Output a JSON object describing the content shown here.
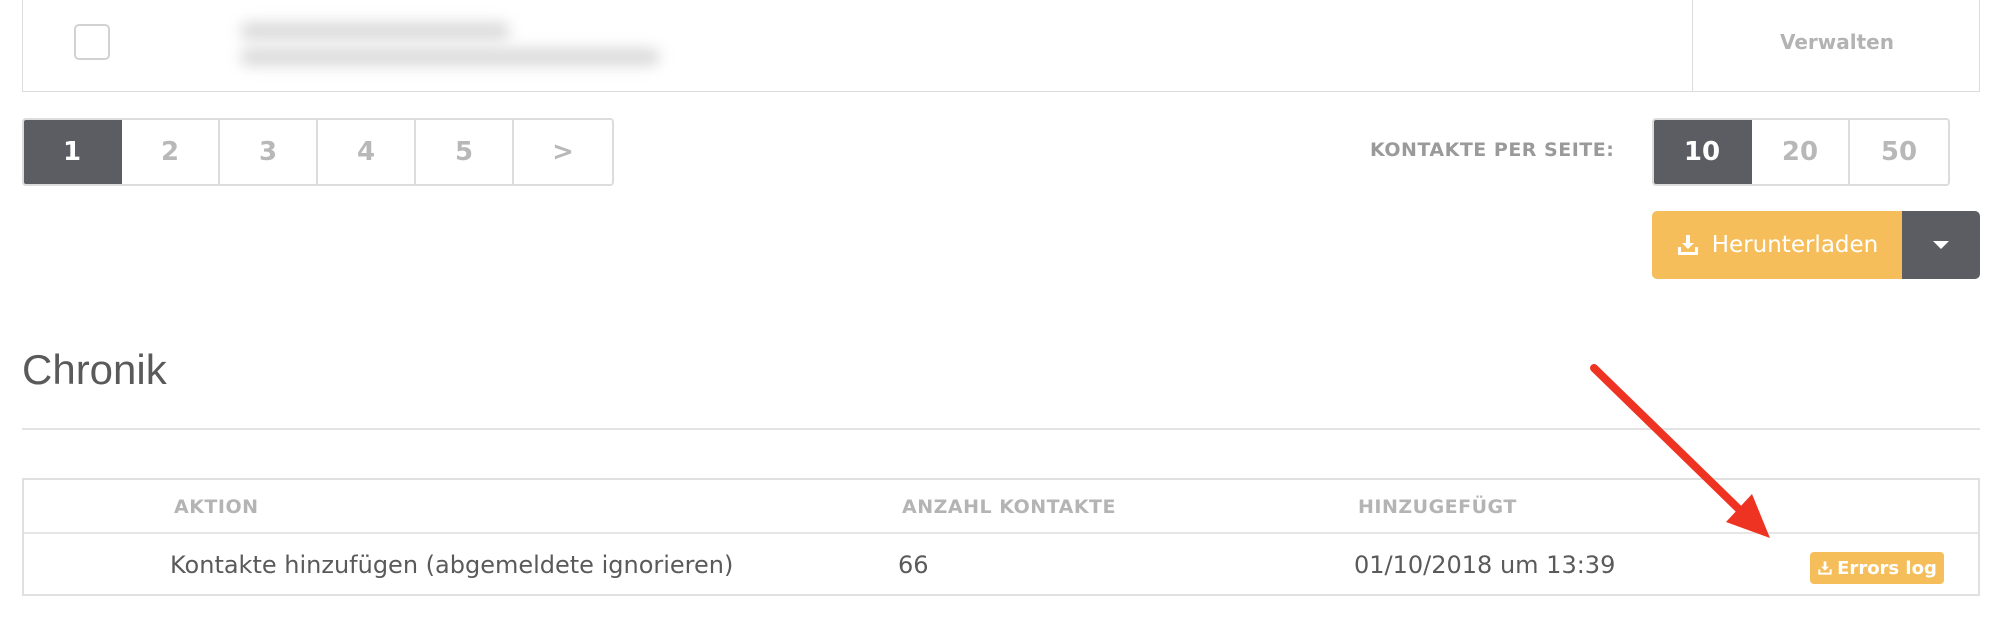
{
  "contact_row": {
    "manage_label": "Verwalten"
  },
  "pagination": {
    "pages": [
      "1",
      "2",
      "3",
      "4",
      "5",
      ">"
    ],
    "active": "1"
  },
  "per_page": {
    "label": "KONTAKTE PER SEITE:",
    "options": [
      "10",
      "20",
      "50"
    ],
    "active": "10"
  },
  "download": {
    "label": "Herunterladen",
    "icon": "download-icon"
  },
  "history": {
    "title": "Chronik",
    "columns": [
      "AKTION",
      "ANZAHL KONTAKTE",
      "HINZUGEFÜGT"
    ],
    "rows": [
      {
        "action": "Kontakte hinzufügen (abgemeldete ignorieren)",
        "count": "66",
        "added": "01/10/2018 um 13:39",
        "button_label": "Errors log"
      }
    ]
  },
  "colors": {
    "accent": "#f5be5a",
    "dark": "#5b5d63",
    "annotation": "#ee3322"
  }
}
